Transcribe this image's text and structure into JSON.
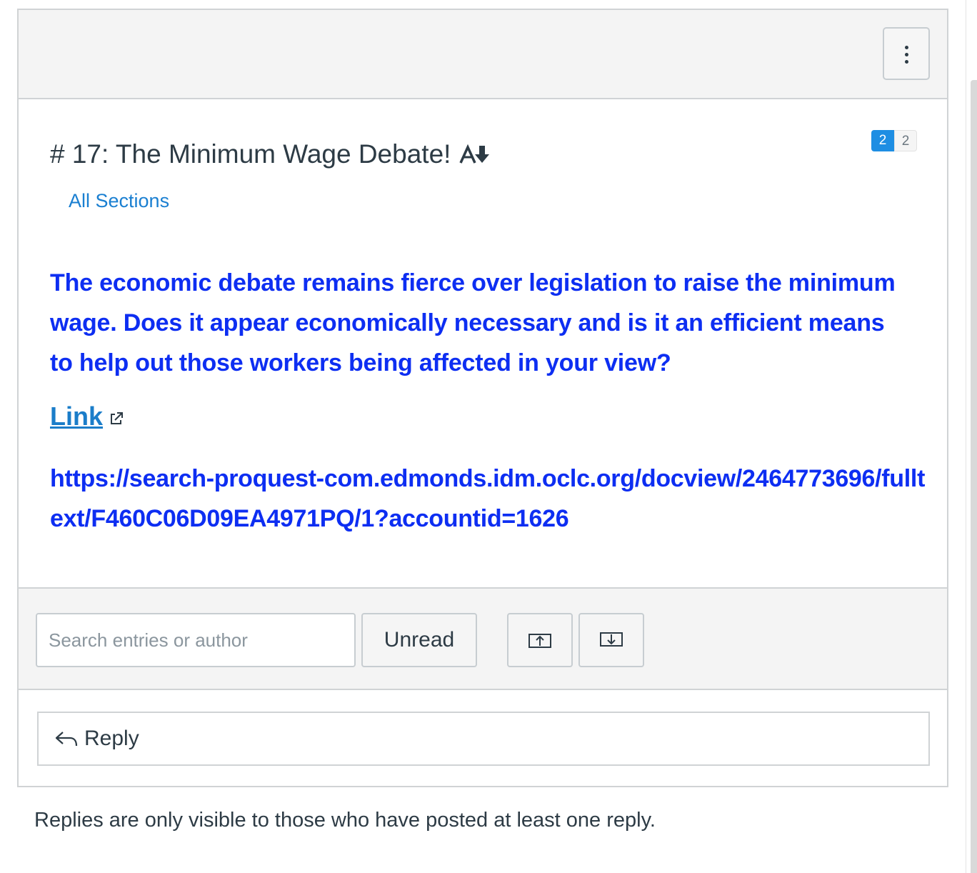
{
  "header": {
    "menu_icon": "kebab-menu-icon"
  },
  "topic": {
    "title": "# 17: The Minimum Wage Debate!",
    "sort_icon": "subscribe-sort-icon",
    "unread_count": "2",
    "total_count": "2",
    "sections_label": "All Sections"
  },
  "body": {
    "question": "The economic debate remains fierce over legislation to raise the minimum wage.  Does it appear economically necessary and is it an efficient means to help out those workers being affected in your view?",
    "link_label": "Link",
    "link_icon": "external-link-icon",
    "url": "https://search-proquest-com.edmonds.idm.oclc.org/docview/2464773696/fulltext/F460C06D09EA4971PQ/1?accountid=1626"
  },
  "toolbar": {
    "search_placeholder": "Search entries or author",
    "search_value": "",
    "unread_label": "Unread",
    "collapse_icon": "collapse-threads-icon",
    "expand_icon": "expand-threads-icon"
  },
  "reply": {
    "label": "Reply",
    "icon": "reply-arrow-icon"
  },
  "footer": {
    "note": "Replies are only visible to those who have posted at least one reply."
  },
  "colors": {
    "accent": "#1e8ee3",
    "question_text": "#0d2ef2",
    "link": "#1b7dc9",
    "toolbar_bg": "#f4f4f4",
    "border": "#d0d3d5"
  }
}
